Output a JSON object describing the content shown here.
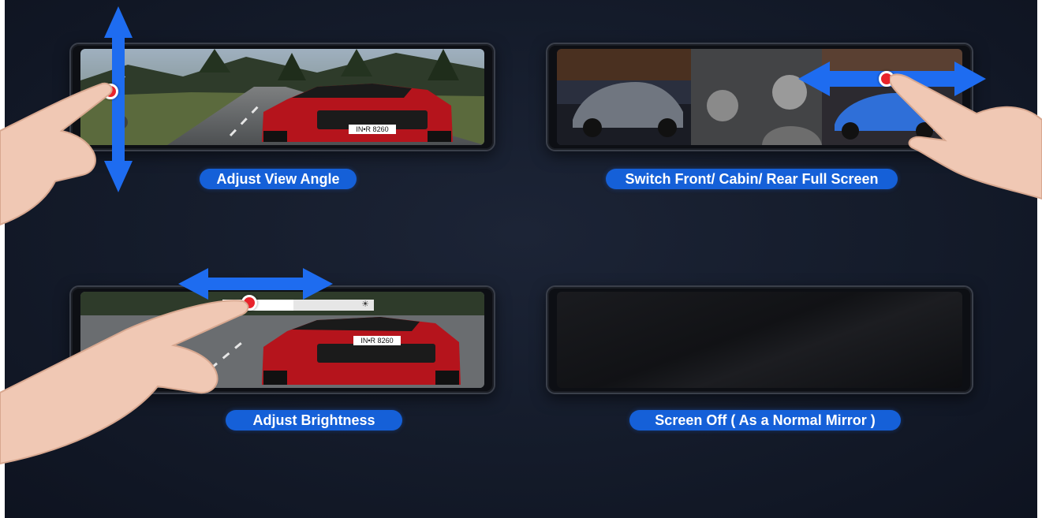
{
  "panels": [
    {
      "label": "Adjust View Angle",
      "plate_text": "IN•R 8260"
    },
    {
      "label": "Switch Front/ Cabin/ Rear Full Screen"
    },
    {
      "label": "Adjust Brightness",
      "plate_text": "IN•R 8260"
    },
    {
      "label": "Screen Off ( As a Normal Mirror )"
    }
  ],
  "colors": {
    "accent": "#1560d8",
    "arrow": "#1e6cf0",
    "touch_dot": "#e8232b"
  }
}
